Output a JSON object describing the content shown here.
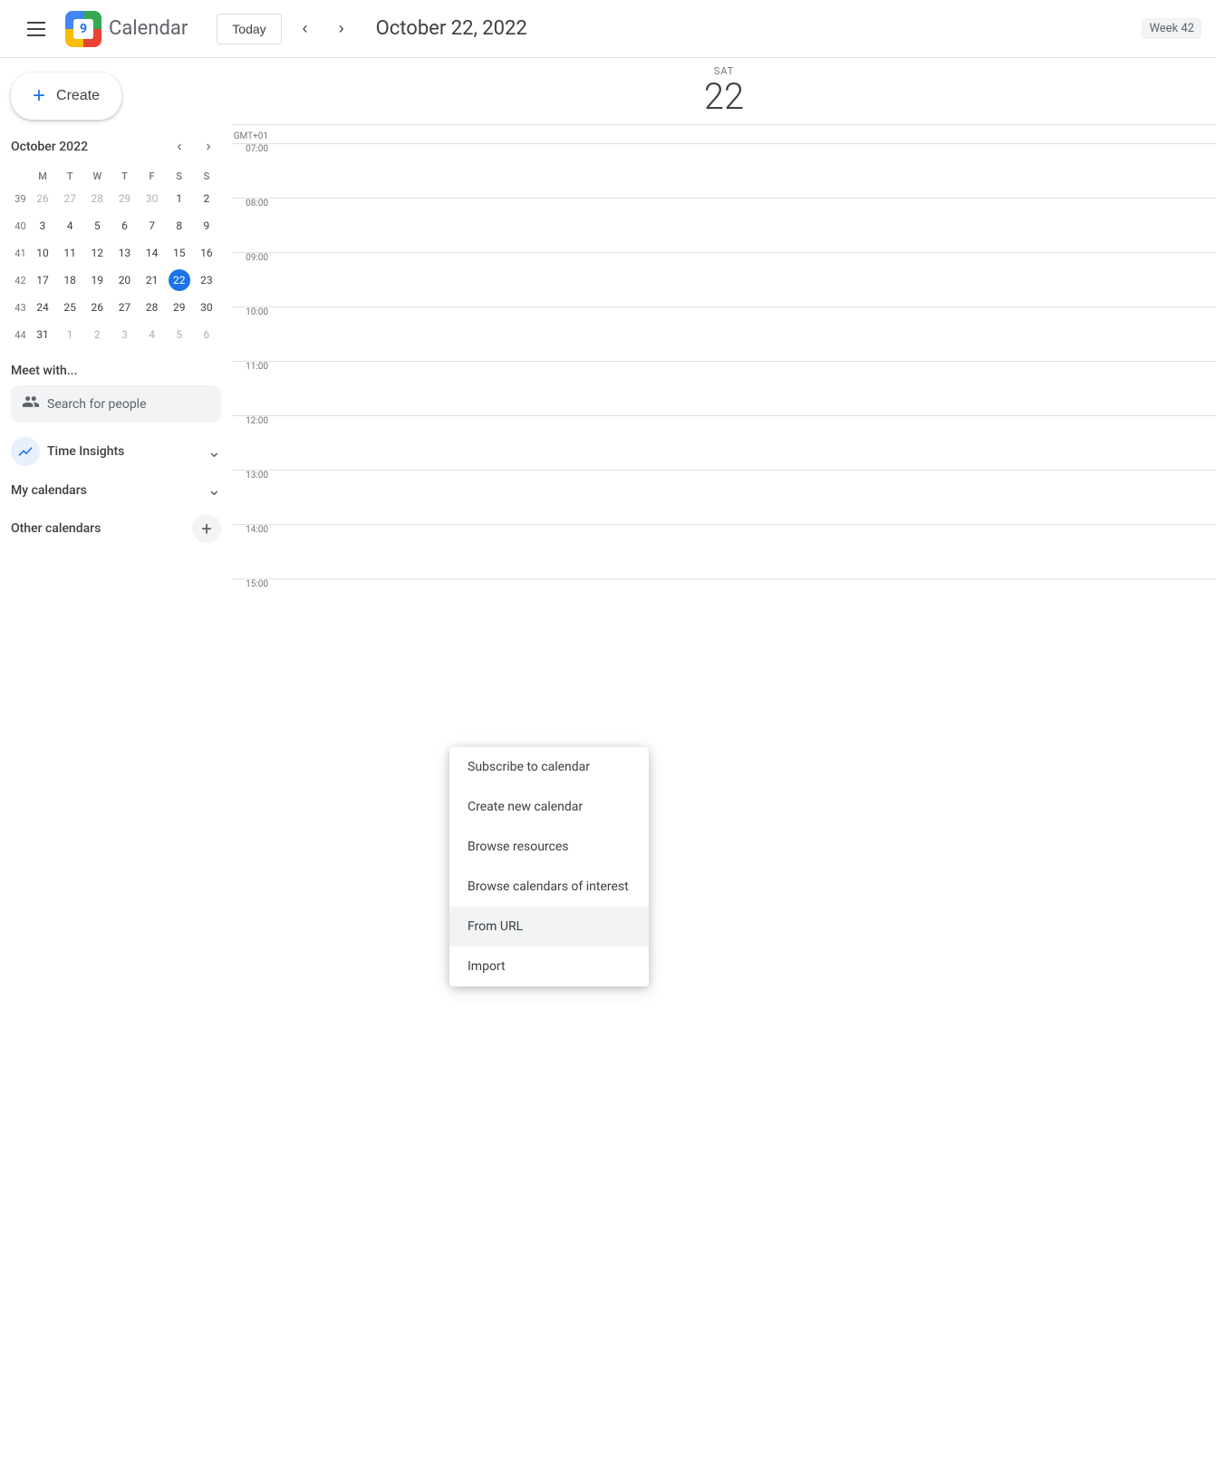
{
  "header": {
    "app_title": "Calendar",
    "today_label": "Today",
    "date_display": "October 22, 2022",
    "week_badge": "Week 42",
    "logo_number": "9"
  },
  "create_button": {
    "label": "Create"
  },
  "mini_calendar": {
    "title": "October 2022",
    "weekdays": [
      "M",
      "T",
      "W",
      "T",
      "F",
      "S",
      "S"
    ],
    "weeks": [
      {
        "week_num": "39",
        "days": [
          {
            "num": "26",
            "other": true
          },
          {
            "num": "27",
            "other": true
          },
          {
            "num": "28",
            "other": true
          },
          {
            "num": "29",
            "other": true
          },
          {
            "num": "30",
            "other": true
          },
          {
            "num": "1",
            "today": false
          },
          {
            "num": "2",
            "today": false
          }
        ]
      },
      {
        "week_num": "40",
        "days": [
          {
            "num": "3"
          },
          {
            "num": "4"
          },
          {
            "num": "5"
          },
          {
            "num": "6"
          },
          {
            "num": "7"
          },
          {
            "num": "8"
          },
          {
            "num": "9"
          }
        ]
      },
      {
        "week_num": "41",
        "days": [
          {
            "num": "10"
          },
          {
            "num": "11"
          },
          {
            "num": "12"
          },
          {
            "num": "13"
          },
          {
            "num": "14"
          },
          {
            "num": "15"
          },
          {
            "num": "16"
          }
        ]
      },
      {
        "week_num": "42",
        "days": [
          {
            "num": "17"
          },
          {
            "num": "18"
          },
          {
            "num": "19"
          },
          {
            "num": "20"
          },
          {
            "num": "21"
          },
          {
            "num": "22",
            "today": true
          },
          {
            "num": "23"
          }
        ]
      },
      {
        "week_num": "43",
        "days": [
          {
            "num": "24"
          },
          {
            "num": "25"
          },
          {
            "num": "26"
          },
          {
            "num": "27"
          },
          {
            "num": "28"
          },
          {
            "num": "29"
          },
          {
            "num": "30"
          }
        ]
      },
      {
        "week_num": "44",
        "days": [
          {
            "num": "31"
          },
          {
            "num": "1",
            "other": true
          },
          {
            "num": "2",
            "other": true
          },
          {
            "num": "3",
            "other": true
          },
          {
            "num": "4",
            "other": true
          },
          {
            "num": "5",
            "other": true
          },
          {
            "num": "6",
            "other": true
          }
        ]
      }
    ]
  },
  "meet_with": {
    "title": "Meet with...",
    "search_placeholder": "Search for people"
  },
  "time_insights": {
    "label": "Time Insights"
  },
  "my_calendars": {
    "label": "My calendars"
  },
  "other_calendars": {
    "label": "Other calendars"
  },
  "day_view": {
    "day_name": "SAT",
    "day_number": "22",
    "timezone": "GMT+01",
    "time_slots": [
      "07:00",
      "08:00",
      "09:00",
      "10:00",
      "11:00",
      "12:00",
      "13:00",
      "14:00",
      "15:00"
    ]
  },
  "context_menu": {
    "items": [
      {
        "label": "Subscribe to calendar",
        "highlighted": false
      },
      {
        "label": "Create new calendar",
        "highlighted": false
      },
      {
        "label": "Browse resources",
        "highlighted": false
      },
      {
        "label": "Browse calendars of interest",
        "highlighted": false
      },
      {
        "label": "From URL",
        "highlighted": true
      },
      {
        "label": "Import",
        "highlighted": false
      }
    ]
  }
}
